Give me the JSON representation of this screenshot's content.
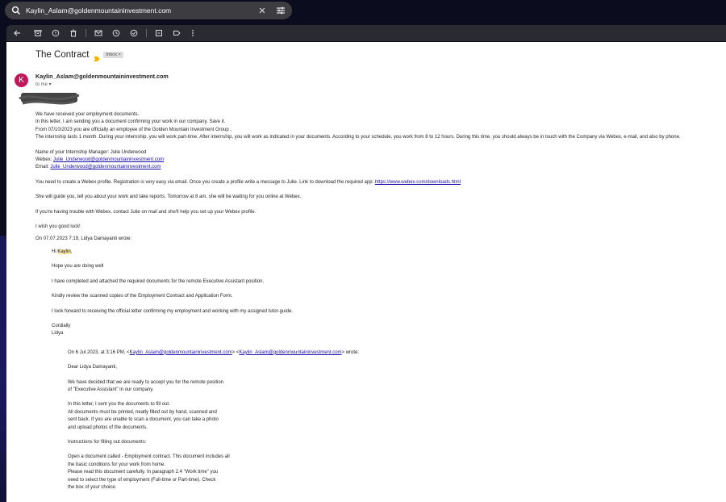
{
  "search": {
    "query": "Kaylin_Aslam@goldenmountaininvestment.com",
    "clear_icon": "close-icon",
    "tune_icon": "tune-icon"
  },
  "toolbar": {
    "icons": [
      "back-arrow-icon",
      "archive-icon",
      "report-spam-icon",
      "delete-icon",
      "mark-unread-icon",
      "snooze-icon",
      "add-task-icon",
      "move-to-icon",
      "label-icon",
      "more-icon"
    ]
  },
  "email": {
    "subject": "The Contract",
    "label_chip": "Inbox ×",
    "avatar_letter": "K",
    "avatar_color": "#c2185b",
    "sender": "Kaylin_Aslam@goldenmountaininvestment.com",
    "to": "to me ▾",
    "body": {
      "l1": "We have received your employment documents.",
      "l2": "In this letter, I am sending you a document confirming your work in our company. Save it.",
      "l3": "From 07/10/2023 you are officially an employee of the Golden Mountain Investment Group .",
      "l4": "The internship lasts 1 month. During your internship, you will work part-time. After internship, you will work as indicated in your documents. According to your schedule, you work from 8 to 12 hours. During this time, you should always be in touch with the Company via Webex, e-mail, and also by phone.",
      "manager": "Name of your Internship Manager: Julie Underwood",
      "webex_label": "Webex: ",
      "webex_link": "Julie_Underwood@goldenmountaininvestment.com",
      "email_label": "Email: ",
      "email_link": "Julie_Underwood@goldenmountaininvestment.com",
      "profile_text": "You need to create a Webex profile. Registration is very easy via email. Once you create a profile write a message to Julie. Link to download the required app: ",
      "profile_link": "https://www.webex.com/downloads.html",
      "guide": "She will guide you, tell you about your work and take reports. Tomorrow at 8 am, she will be waiting for you online at Webex.",
      "trouble": "If you're having trouble with Webex, contact Julie on mail and she'll help you set up your Webex profile.",
      "luck": "I wish you good luck!",
      "quote_header": "On 07.07.2023 7:19, Lidya Damayanti wrote:"
    },
    "quote1": {
      "hi_prefix": "Hi ",
      "hi_name": "Kaylin",
      "hi_suffix": ",",
      "hope": "Hope you are doing well",
      "completed": "I have completed and attached the required documents for the remote Executive Assistant position.",
      "review": "Kindly review the scanned copies of the Employment Contract and Application Form.",
      "forward": "I look forward to receiving the official letter confirming my employment and working with my assigned tutor-guide.",
      "cordially": "Cordially",
      "name": "Lidya"
    },
    "quote2": {
      "header_prefix": "On 6 Jul 2023, at 3:16 PM, <",
      "header_link1": "Kaylin_Aslam@goldenmountaininvestment.com",
      "header_mid": "> <",
      "header_link2": "Kaylin_Aslam@goldenmountaininvestment.com",
      "header_suffix": "> wrote:",
      "dear": "Dear Lidya Damayanti,",
      "decided1": "We have decided that we are ready to accept you for the remote position",
      "decided2": "of \"Executive Assistant\" in our company.",
      "sent1": "In this letter, I sent you the documents to fill out.",
      "sent2": "All documents must be printed, neatly filled out by hand, scanned and",
      "sent3": "sent back. If you are unable to scan a document, you can take a photo",
      "sent4": "and upload photos of the documents.",
      "instructions": "Instructions for filling out documents:",
      "open1": "Open a document called - Employment contract. This document includes all",
      "open2": "the basic conditions for your work from home.",
      "open3": "Please read this document carefully. In paragraph 2.4 \"Work time\" you",
      "open4": "need to select the type of employment (Full-time or Part-time). Check",
      "open5": "the box of your choice."
    }
  }
}
